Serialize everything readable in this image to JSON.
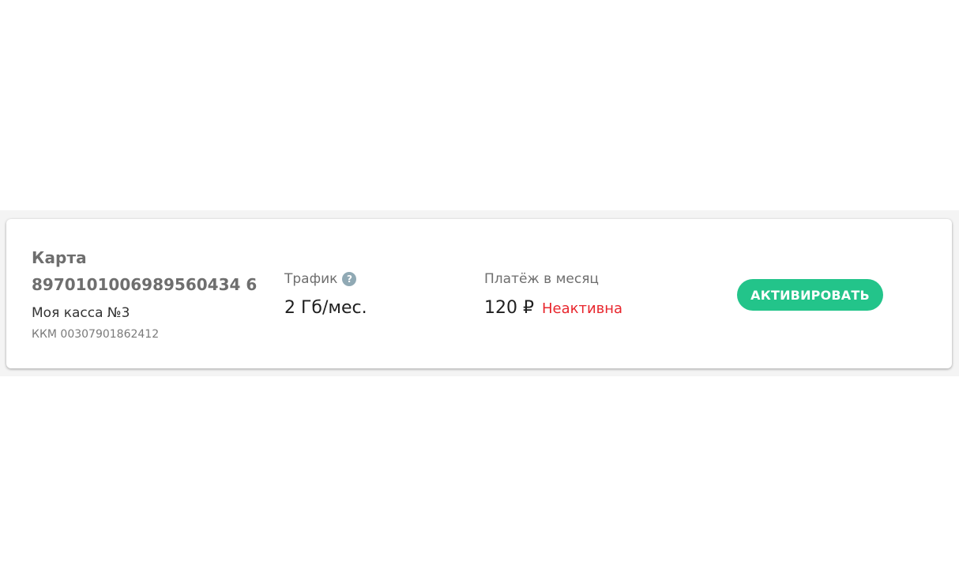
{
  "card": {
    "title": "Карта",
    "number": "8970101006989560434 6",
    "kassa_name": "Моя касса №3",
    "kkm": "ККМ 00307901862412"
  },
  "traffic": {
    "label": "Трафик",
    "help_icon": "question-circle-icon",
    "value": "2 Гб/мес."
  },
  "payment": {
    "label": "Платёж в месяц",
    "amount": "120 ₽",
    "status": "Неактивна"
  },
  "actions": {
    "activate_label": "АКТИВИРОВАТЬ"
  },
  "colors": {
    "accent": "#23c48a",
    "status_inactive": "#e8262d",
    "help_icon": "#90a9b4"
  }
}
